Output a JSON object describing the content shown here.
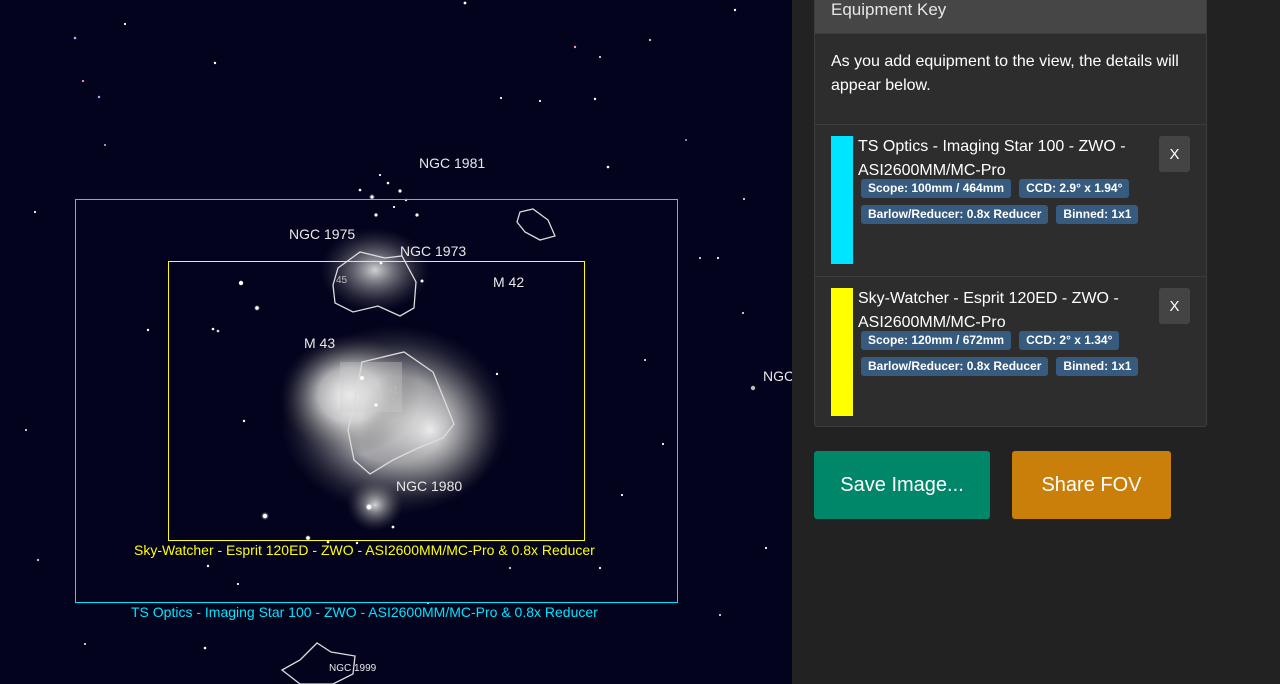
{
  "sky": {
    "labels": {
      "ngc1981": "NGC 1981",
      "ngc1975": "NGC 1975",
      "ngc1973": "NGC 1973",
      "m42": "M 42",
      "m43": "M 43",
      "ngc1980": "NGC 1980",
      "ngc_edge": "NGC",
      "ngc1999": "NGC 1999",
      "n45": "45",
      "n41": "41"
    },
    "fov_captions": {
      "skywatcher": "Sky-Watcher - Esprit 120ED - ZWO - ASI2600MM/MC-Pro  & 0.8x Reducer",
      "tsoptics": "TS Optics - Imaging Star 100 - ZWO - ASI2600MM/MC-Pro  & 0.8x Reducer"
    }
  },
  "equipment_key": {
    "title": "Equipment Key",
    "intro": "As you add equipment to the view, the details will appear below.",
    "items": [
      {
        "title": "TS Optics - Imaging Star 100 - ZWO - ASI2600MM/MC-Pro",
        "scope": "Scope: 100mm / 464mm",
        "ccd": "CCD: 2.9° x 1.94°",
        "barlow": "Barlow/Reducer: 0.8x Reducer",
        "binned": "Binned: 1x1",
        "remove_label": "X"
      },
      {
        "title": "Sky-Watcher - Esprit 120ED - ZWO - ASI2600MM/MC-Pro",
        "scope": "Scope: 120mm / 672mm",
        "ccd": "CCD: 2° x 1.34°",
        "barlow": "Barlow/Reducer: 0.8x Reducer",
        "binned": "Binned: 1x1",
        "remove_label": "X"
      }
    ]
  },
  "actions": {
    "save_label": "Save Image...",
    "share_label": "Share FOV"
  },
  "colors": {
    "sky_background": "#03031e",
    "panel_background": "#222222",
    "fov_ts_optics": "#00e5ff",
    "fov_skywatcher": "#ffff00",
    "badge": "#375a7f",
    "save_button": "#00876a",
    "share_button": "#c97f0a"
  }
}
